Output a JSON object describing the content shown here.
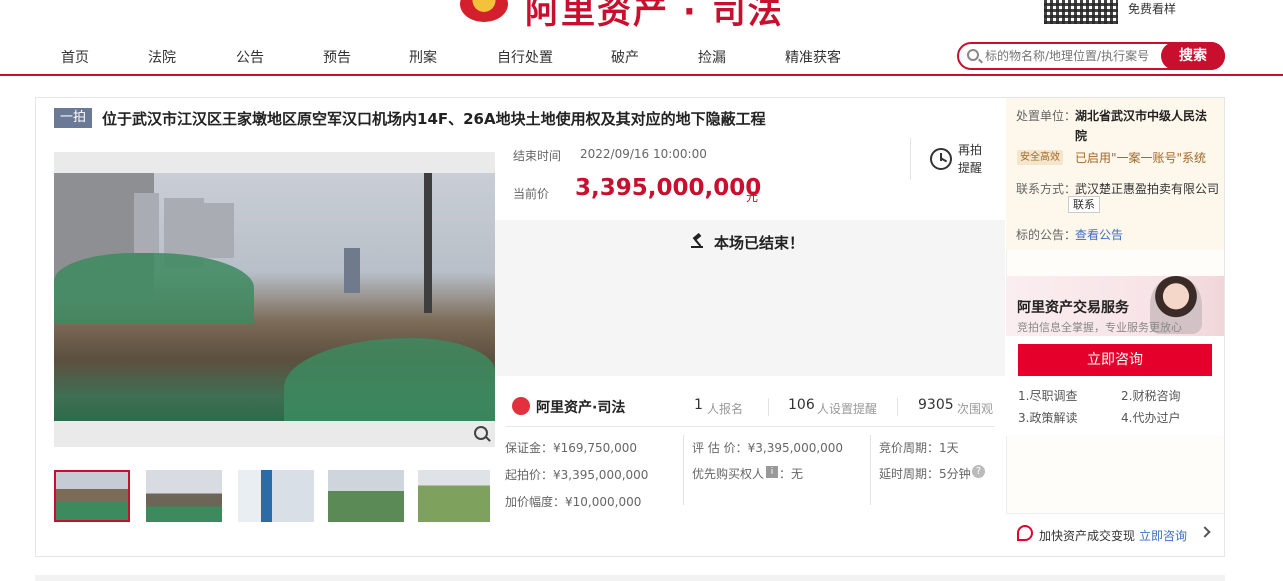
{
  "header": {
    "logo_text": "阿里资产 · 司法",
    "qr_label": "免费看样"
  },
  "nav": {
    "items": [
      "首页",
      "法院",
      "公告",
      "预告",
      "刑案",
      "自行处置",
      "破产",
      "捡漏",
      "精准获客"
    ],
    "search_placeholder": "标的物名称/地理位置/执行案号",
    "search_button": "搜索"
  },
  "auction": {
    "badge": "一拍",
    "title": "位于武汉市江汉区王家墩地区原空军汉口机场内14F、26A地块土地使用权及其对应的地下隐蔽工程",
    "end_label": "结束时间",
    "end_time": "2022/09/16 10:00:00",
    "current_label": "当前价",
    "current_price": "3,395,000,000",
    "price_unit": "元",
    "remind_label": "再拍提醒",
    "ended_text": "本场已结束！",
    "platform_logo": "阿里资产·司法",
    "stats": [
      {
        "num": "1",
        "label": "人报名"
      },
      {
        "num": "106",
        "label": "人设置提醒"
      },
      {
        "num": "9305",
        "label": "次围观"
      }
    ],
    "details": [
      "保证金：¥169,750,000",
      "评 估 价：¥3,395,000,000",
      "竞价周期：1天",
      "起拍价：¥3,395,000,000",
      "优先购买权人",
      "：无",
      "延时周期：5分钟",
      "加价幅度：¥10,000,000"
    ],
    "priority_tag": "i"
  },
  "side": {
    "court_label": "处置单位：",
    "court_name": "湖北省武汉市中级人民法",
    "court_name_2": "院",
    "sys_badge": "安全高效",
    "sys_text": "已启用\"一案一账号\"系统",
    "contact_label": "联系方式：",
    "contact_value": "武汉楚正惠盈拍卖有限公司",
    "contact_button": "联系",
    "notice_label": "标的公告：",
    "notice_link": "查看公告",
    "service_title": "阿里资产交易服务",
    "service_sub": "竞拍信息全掌握，专业服务更放心",
    "consult_button": "立即咨询",
    "service_items": [
      "1.尽职调查",
      "2.财税咨询",
      "3.政策解读",
      "4.代办过户"
    ],
    "bottom_text": "加快资产成交变现",
    "bottom_link": "立即咨询"
  }
}
